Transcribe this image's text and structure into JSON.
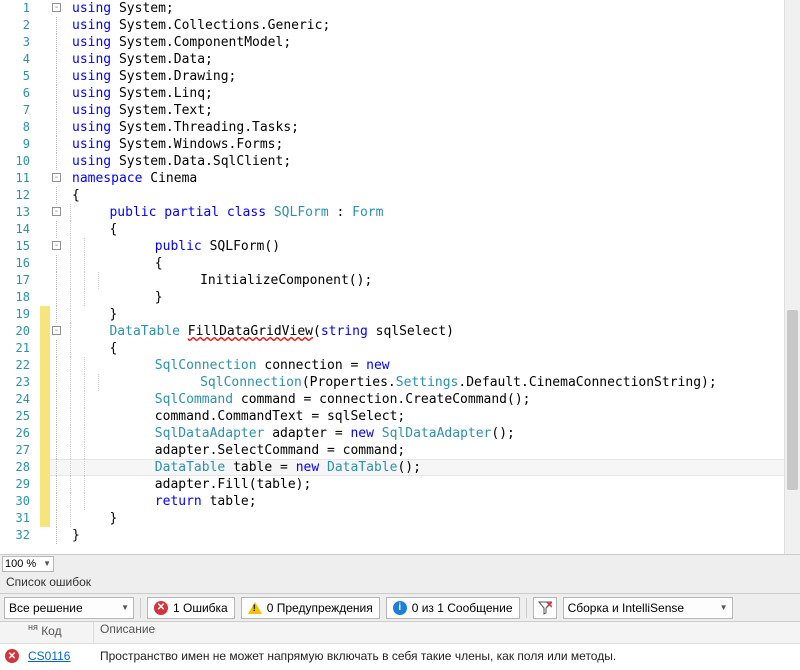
{
  "code": {
    "lines": [
      {
        "n": 1,
        "indent": 0,
        "box": "-",
        "tokens": [
          [
            "k",
            "using "
          ],
          [
            "plain",
            "System;"
          ]
        ]
      },
      {
        "n": 2,
        "indent": 0,
        "tokens": [
          [
            "k",
            "using "
          ],
          [
            "plain",
            "System.Collections.Generic;"
          ]
        ]
      },
      {
        "n": 3,
        "indent": 0,
        "tokens": [
          [
            "k",
            "using "
          ],
          [
            "plain",
            "System.ComponentModel;"
          ]
        ]
      },
      {
        "n": 4,
        "indent": 0,
        "tokens": [
          [
            "k",
            "using "
          ],
          [
            "plain",
            "System.Data;"
          ]
        ]
      },
      {
        "n": 5,
        "indent": 0,
        "tokens": [
          [
            "k",
            "using "
          ],
          [
            "plain",
            "System.Drawing;"
          ]
        ]
      },
      {
        "n": 6,
        "indent": 0,
        "tokens": [
          [
            "k",
            "using "
          ],
          [
            "plain",
            "System.Linq;"
          ]
        ]
      },
      {
        "n": 7,
        "indent": 0,
        "tokens": [
          [
            "k",
            "using "
          ],
          [
            "plain",
            "System.Text;"
          ]
        ]
      },
      {
        "n": 8,
        "indent": 0,
        "tokens": [
          [
            "k",
            "using "
          ],
          [
            "plain",
            "System.Threading.Tasks;"
          ]
        ]
      },
      {
        "n": 9,
        "indent": 0,
        "tokens": [
          [
            "k",
            "using "
          ],
          [
            "plain",
            "System.Windows.Forms;"
          ]
        ]
      },
      {
        "n": 10,
        "indent": 0,
        "tokens": [
          [
            "k",
            "using "
          ],
          [
            "plain",
            "System.Data.SqlClient;"
          ]
        ]
      },
      {
        "n": 11,
        "indent": 0,
        "box": "-",
        "tokens": [
          [
            "k",
            "namespace "
          ],
          [
            "plain",
            "Cinema"
          ]
        ]
      },
      {
        "n": 12,
        "indent": 0,
        "tokens": [
          [
            "plain",
            "{"
          ]
        ]
      },
      {
        "n": 13,
        "indent": 1,
        "box": "-",
        "tokens": [
          [
            "plain",
            "   "
          ],
          [
            "k",
            "public partial class "
          ],
          [
            "t",
            "SQLForm"
          ],
          [
            "plain",
            " : "
          ],
          [
            "t",
            "Form"
          ]
        ]
      },
      {
        "n": 14,
        "indent": 1,
        "tokens": [
          [
            "plain",
            "   {"
          ]
        ]
      },
      {
        "n": 15,
        "indent": 2,
        "box": "-",
        "tokens": [
          [
            "plain",
            "       "
          ],
          [
            "k",
            "public "
          ],
          [
            "plain",
            "SQLForm()"
          ]
        ]
      },
      {
        "n": 16,
        "indent": 2,
        "tokens": [
          [
            "plain",
            "       {"
          ]
        ]
      },
      {
        "n": 17,
        "indent": 3,
        "tokens": [
          [
            "plain",
            "           InitializeComponent();"
          ]
        ]
      },
      {
        "n": 18,
        "indent": 2,
        "tokens": [
          [
            "plain",
            "       }"
          ]
        ]
      },
      {
        "n": 19,
        "indent": 1,
        "changed": true,
        "tokens": [
          [
            "plain",
            "   }"
          ]
        ]
      },
      {
        "n": 20,
        "indent": 1,
        "box": "-",
        "changed": true,
        "tokens": [
          [
            "plain",
            "   "
          ],
          [
            "t",
            "DataTable "
          ],
          [
            "sq",
            "FillDataGridView"
          ],
          [
            "plain",
            "("
          ],
          [
            "k",
            "string "
          ],
          [
            "plain",
            "sqlSelect)"
          ]
        ]
      },
      {
        "n": 21,
        "indent": 1,
        "changed": true,
        "tokens": [
          [
            "plain",
            "   {"
          ]
        ]
      },
      {
        "n": 22,
        "indent": 2,
        "changed": true,
        "tokens": [
          [
            "plain",
            "       "
          ],
          [
            "t",
            "SqlConnection "
          ],
          [
            "plain",
            "connection = "
          ],
          [
            "k",
            "new"
          ]
        ]
      },
      {
        "n": 23,
        "indent": 3,
        "changed": true,
        "tokens": [
          [
            "plain",
            "           "
          ],
          [
            "t",
            "SqlConnection"
          ],
          [
            "plain",
            "(Properties."
          ],
          [
            "t",
            "Settings"
          ],
          [
            "plain",
            ".Default.CinemaConnectionString);"
          ]
        ]
      },
      {
        "n": 24,
        "indent": 2,
        "changed": true,
        "tokens": [
          [
            "plain",
            "       "
          ],
          [
            "t",
            "SqlCommand "
          ],
          [
            "plain",
            "command = connection.CreateCommand();"
          ]
        ]
      },
      {
        "n": 25,
        "indent": 2,
        "changed": true,
        "tokens": [
          [
            "plain",
            "       command.CommandText = sqlSelect;"
          ]
        ]
      },
      {
        "n": 26,
        "indent": 2,
        "changed": true,
        "tokens": [
          [
            "plain",
            "       "
          ],
          [
            "t",
            "SqlDataAdapter "
          ],
          [
            "plain",
            "adapter = "
          ],
          [
            "k",
            "new "
          ],
          [
            "t",
            "SqlDataAdapter"
          ],
          [
            "plain",
            "();"
          ]
        ]
      },
      {
        "n": 27,
        "indent": 2,
        "changed": true,
        "tokens": [
          [
            "plain",
            "       adapter.SelectCommand = command;"
          ]
        ]
      },
      {
        "n": 28,
        "indent": 2,
        "changed": true,
        "highlight": true,
        "tokens": [
          [
            "plain",
            "       "
          ],
          [
            "t",
            "DataTable "
          ],
          [
            "plain",
            "table = "
          ],
          [
            "k",
            "new "
          ],
          [
            "t",
            "DataTable"
          ],
          [
            "plain",
            "();"
          ]
        ]
      },
      {
        "n": 29,
        "indent": 2,
        "changed": true,
        "tokens": [
          [
            "plain",
            "       adapter.Fill(table);"
          ]
        ]
      },
      {
        "n": 30,
        "indent": 2,
        "changed": true,
        "tokens": [
          [
            "plain",
            "       "
          ],
          [
            "k",
            "return "
          ],
          [
            "plain",
            "table;"
          ]
        ]
      },
      {
        "n": 31,
        "indent": 1,
        "changed": true,
        "tokens": [
          [
            "plain",
            "   }"
          ]
        ]
      },
      {
        "n": 32,
        "indent": 0,
        "tokens": [
          [
            "plain",
            "}"
          ]
        ]
      }
    ]
  },
  "zoom": {
    "value": "100 %"
  },
  "error_panel": {
    "title": "Список ошибок",
    "scope": "Все решение",
    "filters": {
      "errors": "1 Ошибка",
      "warnings": "0 Предупреждения",
      "messages": "0 из 1 Сообщение"
    },
    "build_filter": "Сборка и IntelliSense",
    "headers": {
      "code": "Код",
      "description": "Описание"
    },
    "rows": [
      {
        "code": "CS0116",
        "desc": "Пространство имен не может напрямую включать в себя такие члены, как поля или методы."
      }
    ]
  }
}
